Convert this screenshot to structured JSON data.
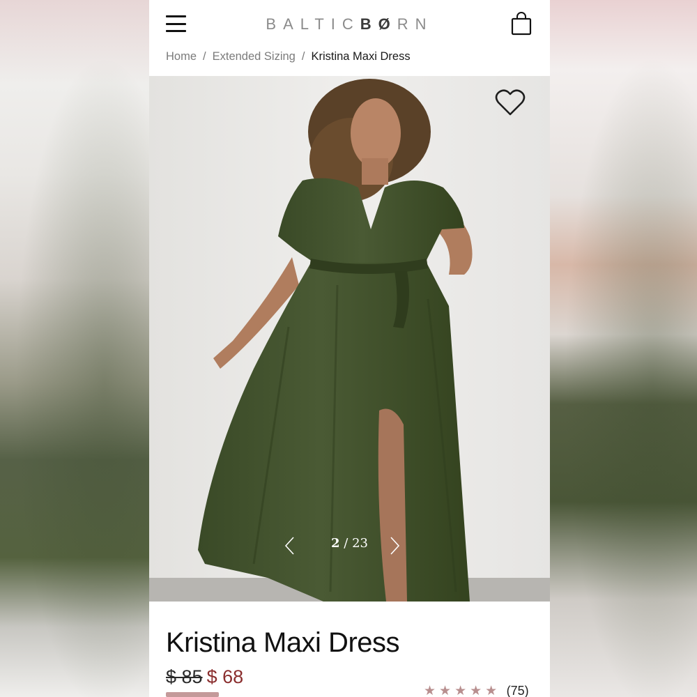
{
  "header": {
    "logo_left": "BALTIC",
    "logo_mid": "BØ",
    "logo_right": "RN"
  },
  "breadcrumb": {
    "items": [
      "Home",
      "Extended Sizing"
    ],
    "separator": "/",
    "current": "Kristina Maxi Dress"
  },
  "gallery": {
    "current": "2",
    "separator": "/",
    "total": "23",
    "dress_color": "#3f4f2c"
  },
  "product": {
    "title": "Kristina Maxi Dress",
    "old_price": "$ 85",
    "sale_price": "$ 68",
    "stars": "★★★★★",
    "review_count": "(75)"
  },
  "colors": {
    "sale_price": "#8a2e2e",
    "star": "#b88f8f",
    "sale_bar": "#c49a9a"
  }
}
